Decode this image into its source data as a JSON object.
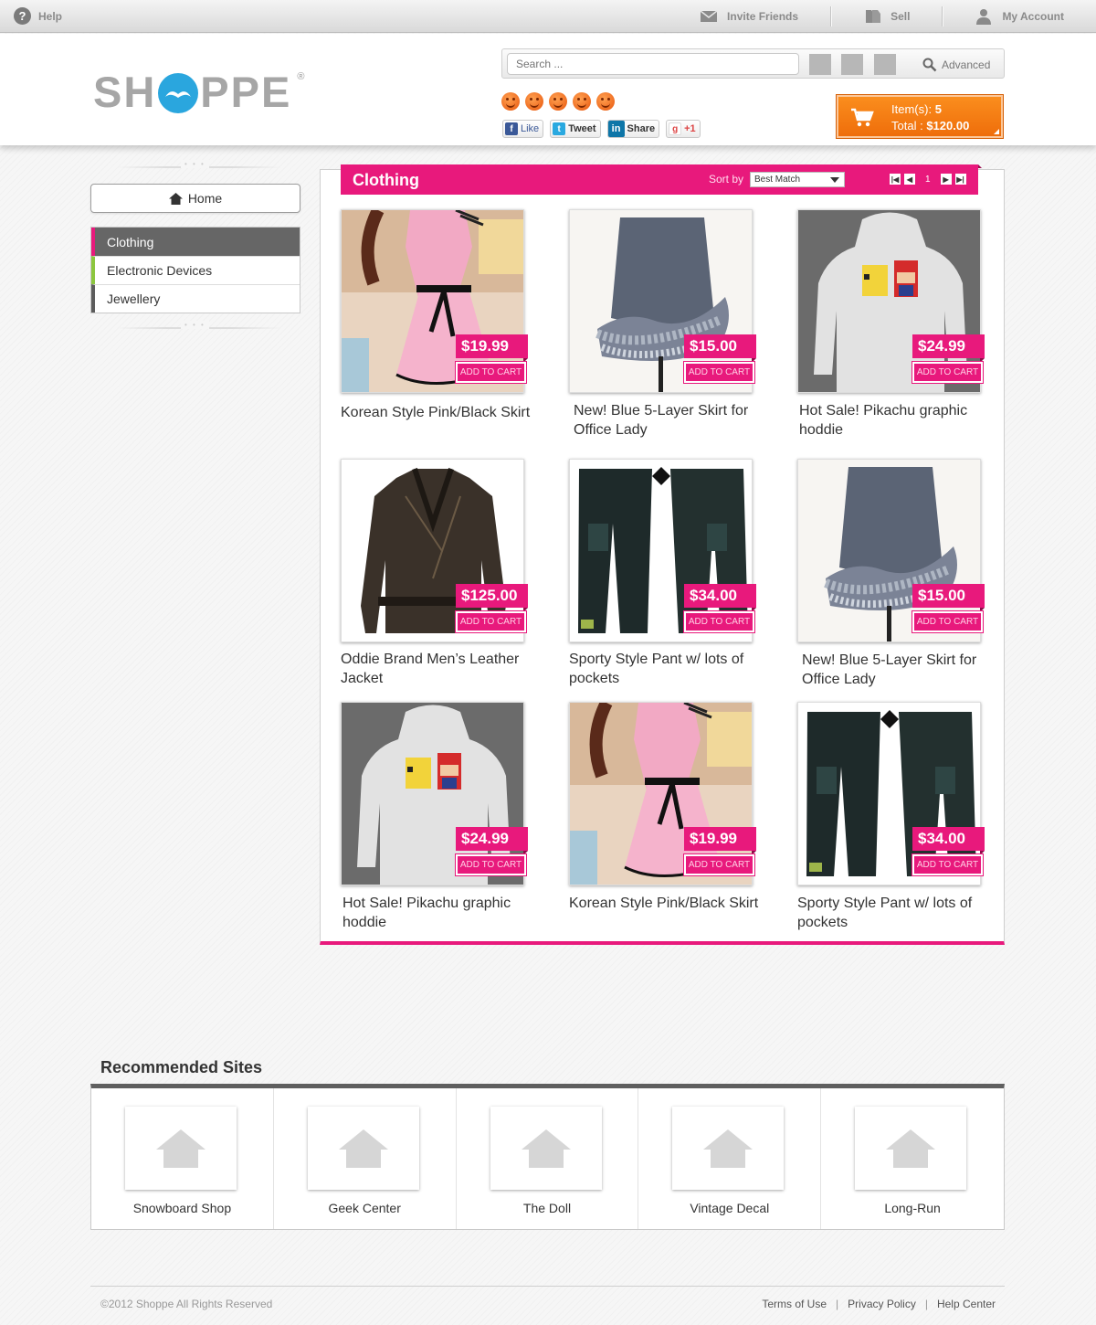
{
  "topbar": {
    "help": "Help",
    "invite": "Invite Friends",
    "sell": "Sell",
    "account": "My Account"
  },
  "header": {
    "logo_left": "SH",
    "logo_right": "PPE",
    "logo_reg": "®",
    "search_placeholder": "Search ...",
    "advanced": "Advanced",
    "rating_icons": 5,
    "social": {
      "like": "Like",
      "tweet": "Tweet",
      "share": "Share",
      "plusone": "+1"
    },
    "cart": {
      "items_label": "Item(s):",
      "items_count": "5",
      "total_label": "Total :",
      "total_value": "$120.00"
    }
  },
  "sidebar": {
    "home": "Home",
    "categories": [
      {
        "label": "Clothing",
        "color": "#e8197c",
        "active": true
      },
      {
        "label": "Electronic Devices",
        "color": "#8cc63e",
        "active": false
      },
      {
        "label": "Jewellery",
        "color": "#5c5c5c",
        "active": false
      }
    ]
  },
  "main": {
    "title": "Clothing",
    "sort_label": "Sort by",
    "sort_value": "Best Match",
    "page": "1",
    "add_to_cart": "ADD TO CART",
    "accent": "#e8197c",
    "products": [
      {
        "name": "Korean Style Pink/Black Skirt",
        "price": "$19.99",
        "image": "pink-dress"
      },
      {
        "name": "New! Blue 5-Layer Skirt for Office Lady",
        "price": "$15.00",
        "image": "blue-skirt"
      },
      {
        "name": "Hot Sale! Pikachu graphic hoddie",
        "price": "$24.99",
        "image": "hoodie"
      },
      {
        "name": "Oddie Brand Men’s Leather Jacket",
        "price": "$125.00",
        "image": "leather-jacket"
      },
      {
        "name": "Sporty Style Pant w/ lots of pockets",
        "price": "$34.00",
        "image": "pants"
      },
      {
        "name": "New! Blue 5-Layer Skirt for Office Lady",
        "price": "$15.00",
        "image": "blue-skirt"
      },
      {
        "name": "Hot Sale! Pikachu graphic hoddie",
        "price": "$24.99",
        "image": "hoodie"
      },
      {
        "name": "Korean Style Pink/Black Skirt",
        "price": "$19.99",
        "image": "pink-dress"
      },
      {
        "name": "Sporty Style Pant w/ lots of pockets",
        "price": "$34.00",
        "image": "pants"
      }
    ]
  },
  "recommended": {
    "title": "Recommended Sites",
    "sites": [
      "Snowboard Shop",
      "Geek Center",
      "The Doll",
      "Vintage Decal",
      "Long-Run"
    ]
  },
  "footer": {
    "copyright": "©2012 Shoppe All Rights Reserved",
    "links": [
      "Terms of Use",
      "Privacy Policy",
      "Help Center"
    ]
  }
}
